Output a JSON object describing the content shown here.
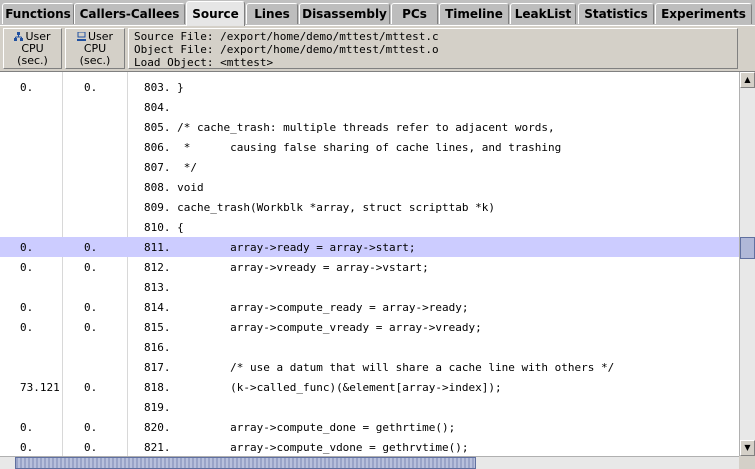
{
  "tabs": [
    {
      "label": "Functions",
      "active": false
    },
    {
      "label": "Callers-Callees",
      "active": false
    },
    {
      "label": "Source",
      "active": true
    },
    {
      "label": "Lines",
      "active": false
    },
    {
      "label": "Disassembly",
      "active": false
    },
    {
      "label": "PCs",
      "active": false
    },
    {
      "label": "Timeline",
      "active": false
    },
    {
      "label": "LeakList",
      "active": false
    },
    {
      "label": "Statistics",
      "active": false
    },
    {
      "label": "Experiments",
      "active": false
    }
  ],
  "header": {
    "col1": {
      "line1": "User",
      "line2": "CPU",
      "line3": "(sec.)",
      "icon": "inclusive-metric-icon"
    },
    "col2": {
      "line1": "User",
      "line2": "CPU",
      "line3": "(sec.)",
      "icon": "exclusive-metric-icon"
    },
    "source_file": "Source File: /export/home/demo/mttest/mttest.c",
    "object_file": "Object File: /export/home/demo/mttest/mttest.o",
    "load_object": "Load Object: <mttest>"
  },
  "rows": [
    {
      "incl": "0.",
      "excl": "0.",
      "line": "803.",
      "code": " }",
      "selected": false
    },
    {
      "incl": "",
      "excl": "",
      "line": "804.",
      "code": "",
      "selected": false
    },
    {
      "incl": "",
      "excl": "",
      "line": "805.",
      "code": " /* cache_trash: multiple threads refer to adjacent words,",
      "selected": false
    },
    {
      "incl": "",
      "excl": "",
      "line": "806.",
      "code": "  *      causing false sharing of cache lines, and trashing",
      "selected": false
    },
    {
      "incl": "",
      "excl": "",
      "line": "807.",
      "code": "  */",
      "selected": false
    },
    {
      "incl": "",
      "excl": "",
      "line": "808.",
      "code": " void",
      "selected": false
    },
    {
      "incl": "",
      "excl": "",
      "line": "809.",
      "code": " cache_trash(Workblk *array, struct scripttab *k)",
      "selected": false
    },
    {
      "incl": "",
      "excl": "",
      "line": "810.",
      "code": " {",
      "selected": false
    },
    {
      "incl": "0.",
      "excl": "0.",
      "line": "811.",
      "code": "         array->ready = array->start;",
      "selected": true
    },
    {
      "incl": "0.",
      "excl": "0.",
      "line": "812.",
      "code": "         array->vready = array->vstart;",
      "selected": false
    },
    {
      "incl": "",
      "excl": "",
      "line": "813.",
      "code": "",
      "selected": false
    },
    {
      "incl": "0.",
      "excl": "0.",
      "line": "814.",
      "code": "         array->compute_ready = array->ready;",
      "selected": false
    },
    {
      "incl": "0.",
      "excl": "0.",
      "line": "815.",
      "code": "         array->compute_vready = array->vready;",
      "selected": false
    },
    {
      "incl": "",
      "excl": "",
      "line": "816.",
      "code": "",
      "selected": false
    },
    {
      "incl": "",
      "excl": "",
      "line": "817.",
      "code": "         /* use a datum that will share a cache line with others */",
      "selected": false
    },
    {
      "incl": "73.121",
      "excl": "0.",
      "line": "818.",
      "code": "         (k->called_func)(&element[array->index]);",
      "selected": false
    },
    {
      "incl": "",
      "excl": "",
      "line": "819.",
      "code": "",
      "selected": false
    },
    {
      "incl": "0.",
      "excl": "0.",
      "line": "820.",
      "code": "         array->compute_done = gethrtime();",
      "selected": false
    },
    {
      "incl": "0.",
      "excl": "0.",
      "line": "821.",
      "code": "         array->compute_vdone = gethrvtime();",
      "selected": false
    }
  ],
  "scroll": {
    "vertical_position": 0.45,
    "horizontal_visible_fraction": 0.65
  },
  "colors": {
    "selection": "#ccccff",
    "panel": "#d4d0c8"
  }
}
